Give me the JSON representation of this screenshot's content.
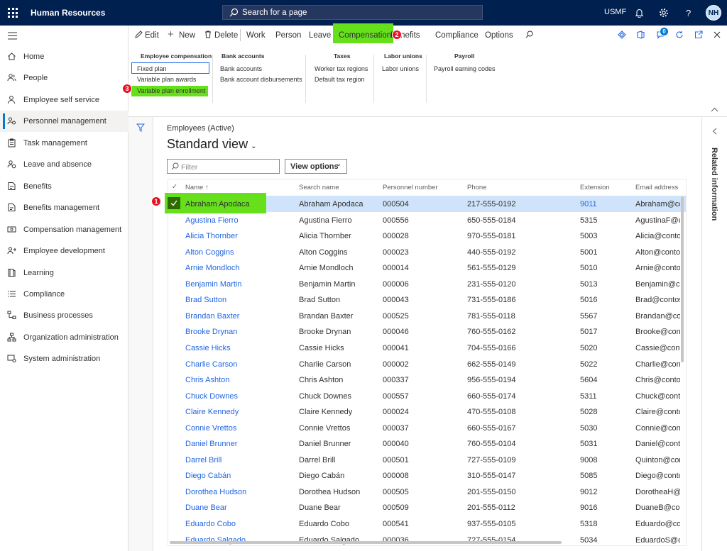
{
  "topbar": {
    "title": "Human Resources",
    "search_placeholder": "Search for a page",
    "company": "USMF",
    "avatar": "NH"
  },
  "nav": [
    {
      "label": "Home",
      "icon": "home-icon"
    },
    {
      "label": "People",
      "icon": "people-icon"
    },
    {
      "label": "Employee self service",
      "icon": "person-icon"
    },
    {
      "label": "Personnel management",
      "icon": "people-settings-icon",
      "active": true
    },
    {
      "label": "Task management",
      "icon": "clipboard-icon"
    },
    {
      "label": "Leave and absence",
      "icon": "person-clock-icon"
    },
    {
      "label": "Benefits",
      "icon": "benefits-icon"
    },
    {
      "label": "Benefits management",
      "icon": "benefits-icon"
    },
    {
      "label": "Compensation management",
      "icon": "money-icon"
    },
    {
      "label": "Employee development",
      "icon": "people-arrow-icon"
    },
    {
      "label": "Learning",
      "icon": "book-icon"
    },
    {
      "label": "Compliance",
      "icon": "list-icon"
    },
    {
      "label": "Business processes",
      "icon": "process-icon"
    },
    {
      "label": "Organization administration",
      "icon": "org-icon"
    },
    {
      "label": "System administration",
      "icon": "admin-icon"
    }
  ],
  "cmdbar": {
    "edit": "Edit",
    "new": "New",
    "delete": "Delete",
    "tabs": [
      "Work",
      "Person",
      "Leave",
      "Compensation",
      "Benefits",
      "Compliance",
      "Options"
    ],
    "notif_count": "0"
  },
  "ribbon": {
    "groups": [
      {
        "title": "Employee compensation",
        "items": [
          "Fixed plan",
          "Variable plan awards",
          "Variable plan enrollment"
        ]
      },
      {
        "title": "Bank accounts",
        "items": [
          "Bank accounts",
          "Bank account disbursements"
        ]
      },
      {
        "title": "Taxes",
        "items": [
          "Worker tax regions",
          "Default tax region"
        ]
      },
      {
        "title": "Labor unions",
        "items": [
          "Labor unions"
        ]
      },
      {
        "title": "Payroll",
        "items": [
          "Payroll earning codes"
        ]
      }
    ]
  },
  "badges": [
    "1",
    "2",
    "3"
  ],
  "page": {
    "caption": "Employees (Active)",
    "view": "Standard view",
    "filter_placeholder": "Filter",
    "view_options": "View options"
  },
  "right_pane": {
    "label": "Related information"
  },
  "grid": {
    "columns": [
      "Name",
      "Search name",
      "Personnel number",
      "Phone",
      "Extension",
      "Email address"
    ],
    "rows": [
      {
        "name": "Abraham Apodaca",
        "search": "Abraham Apodaca",
        "num": "000504",
        "phone": "217-555-0192",
        "ext": "9011",
        "email": "Abraham@co"
      },
      {
        "name": "Agustina Fierro",
        "search": "Agustina Fierro",
        "num": "000556",
        "phone": "650-555-0184",
        "ext": "5315",
        "email": "AgustinaF@c"
      },
      {
        "name": "Alicia Thornber",
        "search": "Alicia Thornber",
        "num": "000028",
        "phone": "970-555-0181",
        "ext": "5003",
        "email": "Alicia@contos"
      },
      {
        "name": "Alton Coggins",
        "search": "Alton Coggins",
        "num": "000023",
        "phone": "440-555-0192",
        "ext": "5001",
        "email": "Alton@contos"
      },
      {
        "name": "Arnie Mondloch",
        "search": "Arnie Mondloch",
        "num": "000014",
        "phone": "561-555-0129",
        "ext": "5010",
        "email": "Arnie@contos"
      },
      {
        "name": "Benjamin Martin",
        "search": "Benjamin Martin",
        "num": "000006",
        "phone": "231-555-0120",
        "ext": "5013",
        "email": "Benjamin@co"
      },
      {
        "name": "Brad Sutton",
        "search": "Brad Sutton",
        "num": "000043",
        "phone": "731-555-0186",
        "ext": "5016",
        "email": "Brad@contoso"
      },
      {
        "name": "Brandan Baxter",
        "search": "Brandan Baxter",
        "num": "000525",
        "phone": "781-555-0118",
        "ext": "5567",
        "email": "Brandan@con"
      },
      {
        "name": "Brooke Drynan",
        "search": "Brooke Drynan",
        "num": "000046",
        "phone": "760-555-0162",
        "ext": "5017",
        "email": "Brooke@cont"
      },
      {
        "name": "Cassie Hicks",
        "search": "Cassie Hicks",
        "num": "000041",
        "phone": "704-555-0166",
        "ext": "5020",
        "email": "Cassie@conto"
      },
      {
        "name": "Charlie Carson",
        "search": "Charlie Carson",
        "num": "000002",
        "phone": "662-555-0149",
        "ext": "5022",
        "email": "Charlie@conto"
      },
      {
        "name": "Chris Ashton",
        "search": "Chris Ashton",
        "num": "000337",
        "phone": "956-555-0194",
        "ext": "5604",
        "email": "Chris@contos"
      },
      {
        "name": "Chuck Downes",
        "search": "Chuck Downes",
        "num": "000557",
        "phone": "660-555-0174",
        "ext": "5311",
        "email": "Chuck@conto"
      },
      {
        "name": "Claire Kennedy",
        "search": "Claire Kennedy",
        "num": "000024",
        "phone": "470-555-0108",
        "ext": "5028",
        "email": "Claire@contos"
      },
      {
        "name": "Connie Vrettos",
        "search": "Connie Vrettos",
        "num": "000037",
        "phone": "660-555-0167",
        "ext": "5030",
        "email": "Connie@conto"
      },
      {
        "name": "Daniel Brunner",
        "search": "Daniel Brunner",
        "num": "000040",
        "phone": "760-555-0104",
        "ext": "5031",
        "email": "Daniel@conto"
      },
      {
        "name": "Darrel Brill",
        "search": "Darrel Brill",
        "num": "000501",
        "phone": "727-555-0109",
        "ext": "9008",
        "email": "Quinton@con"
      },
      {
        "name": "Diego Cabán",
        "search": "Diego Cabán",
        "num": "000008",
        "phone": "310-555-0147",
        "ext": "5085",
        "email": "Diego@conto"
      },
      {
        "name": "Dorothea Hudson",
        "search": "Dorothea Hudson",
        "num": "000505",
        "phone": "201-555-0150",
        "ext": "9012",
        "email": "DorotheaH@c"
      },
      {
        "name": "Duane Bear",
        "search": "Duane Bear",
        "num": "000509",
        "phone": "201-555-0112",
        "ext": "9016",
        "email": "DuaneB@cont"
      },
      {
        "name": "Eduardo Cobo",
        "search": "Eduardo Cobo",
        "num": "000541",
        "phone": "937-555-0105",
        "ext": "5318",
        "email": "Eduardo@con"
      },
      {
        "name": "Eduardo Salgado",
        "search": "Eduardo Salgado",
        "num": "000036",
        "phone": "727-555-0154",
        "ext": "5034",
        "email": "EduardoS@co"
      }
    ]
  }
}
